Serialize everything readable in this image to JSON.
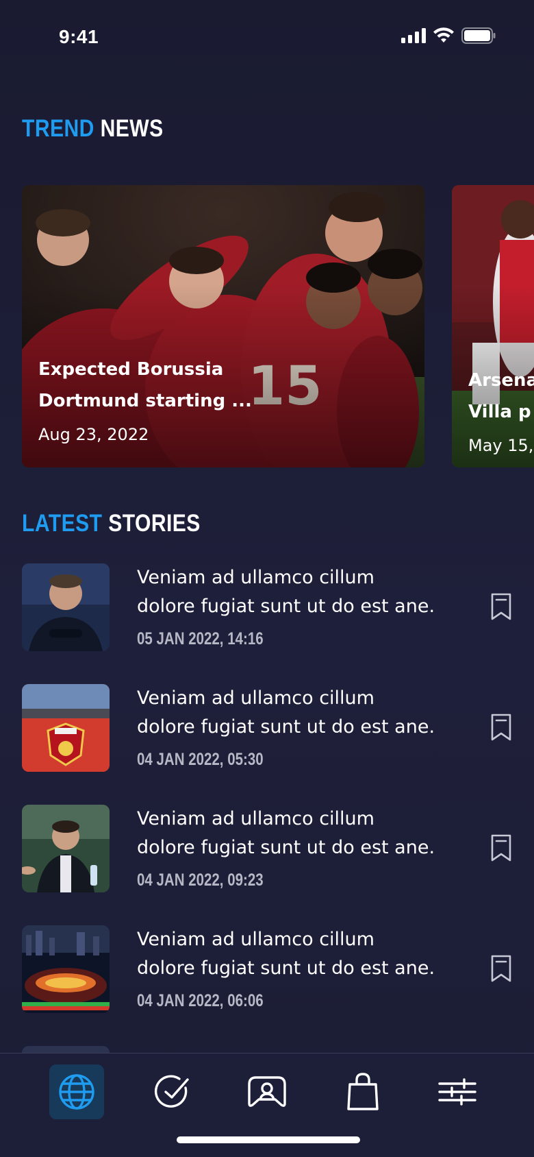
{
  "status_bar": {
    "time": "9:41"
  },
  "trend_section": {
    "accent": "TREND",
    "rest": "NEWS"
  },
  "trend_cards": [
    {
      "title": "Expected Borussia\nDortmund starting ...",
      "date": "Aug 23, 2022"
    },
    {
      "title": "Arsena\nVilla p",
      "date": "May 15,"
    }
  ],
  "latest_section": {
    "accent": "LATEST",
    "rest": "STORIES"
  },
  "stories": [
    {
      "text": "Veniam ad ullamco cillum\ndolore fugiat sunt ut do est ane.",
      "time": "05 JAN 2022, 14:16",
      "thumb": "coach-portrait"
    },
    {
      "text": "Veniam ad ullamco cillum\ndolore fugiat sunt ut do est ane.",
      "time": "04 JAN 2022, 05:30",
      "thumb": "arsenal-stadium"
    },
    {
      "text": "Veniam ad ullamco cillum\ndolore fugiat sunt ut do est ane.",
      "time": "04 JAN 2022, 09:23",
      "thumb": "manager-sideline"
    },
    {
      "text": "Veniam ad ullamco cillum\ndolore fugiat sunt ut do est ane.",
      "time": "04 JAN 2022, 06:06",
      "thumb": "stadium-night"
    }
  ],
  "tab_bar": {
    "items": [
      {
        "icon": "globe-icon",
        "active": true
      },
      {
        "icon": "check-circle-icon",
        "active": false
      },
      {
        "icon": "gamepad-icon",
        "active": false
      },
      {
        "icon": "shopping-bag-icon",
        "active": false
      },
      {
        "icon": "sliders-icon",
        "active": false
      }
    ]
  },
  "colors": {
    "accent": "#1f9bf0",
    "background": "#1b1c33",
    "tab_active": "#17395a"
  }
}
